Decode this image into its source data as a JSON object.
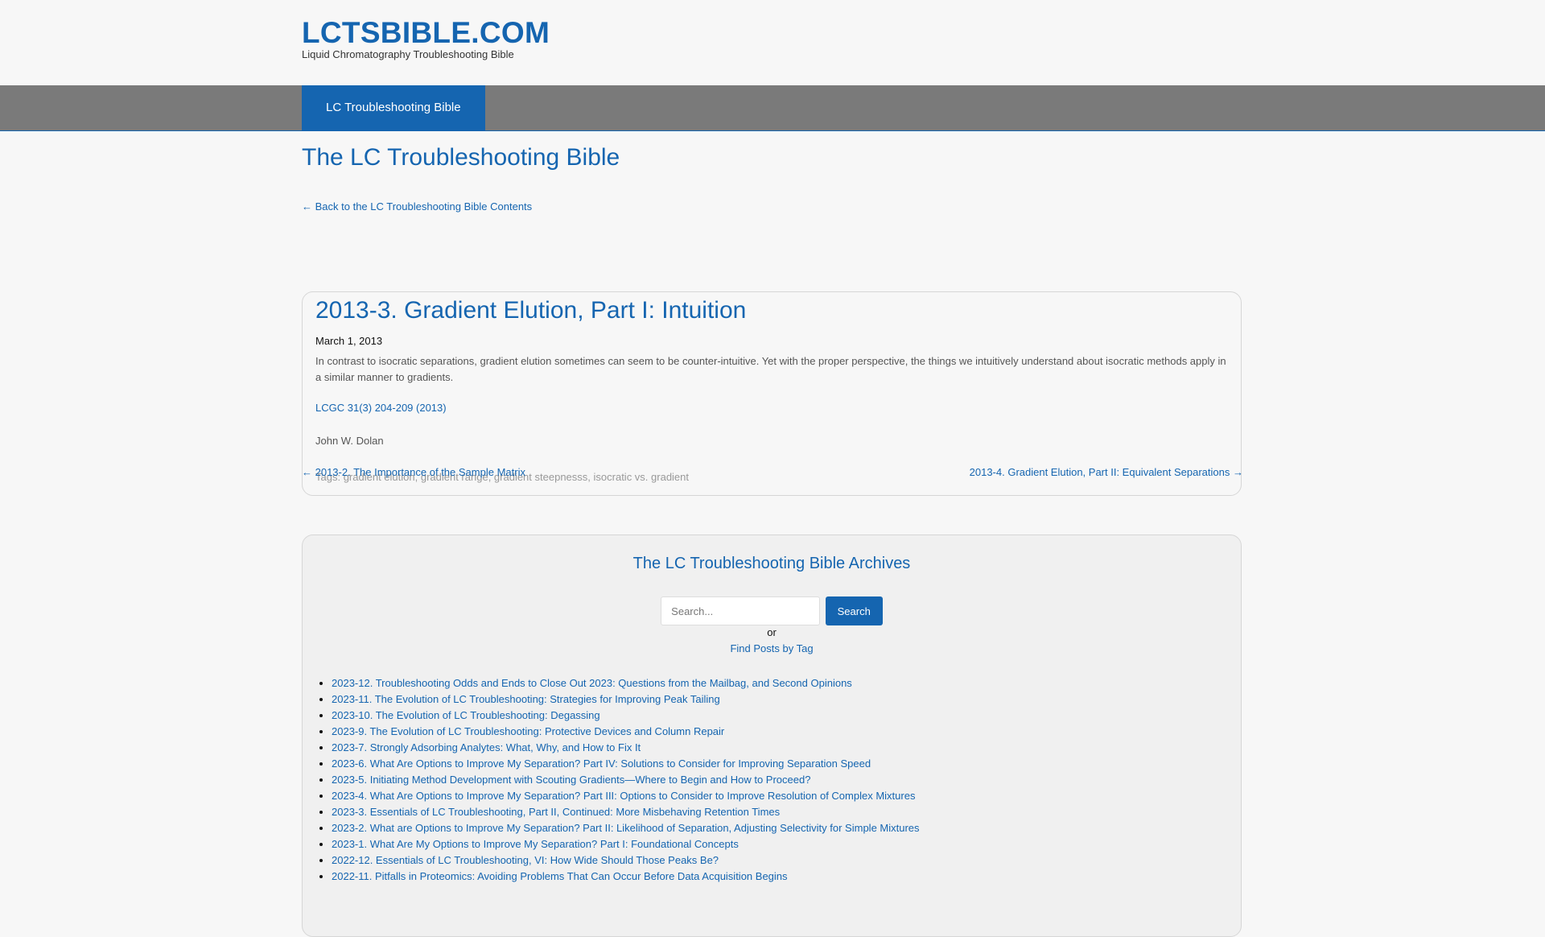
{
  "site": {
    "title": "LCTSBIBLE.COM",
    "description": "Liquid Chromatography Troubleshooting Bible"
  },
  "nav": {
    "items": [
      {
        "label": "LC Troubleshooting Bible"
      }
    ]
  },
  "page": {
    "title": "The LC Troubleshooting Bible",
    "back_link": "← Back to the LC Troubleshooting Bible Contents"
  },
  "post": {
    "title": "2013-3. Gradient Elution, Part I: Intuition",
    "date": "March 1, 2013",
    "body": "In contrast to isocratic separations, gradient elution sometimes can seem to be counter-intuitive. Yet with the proper perspective, the things we intuitively understand about isocratic methods apply in a similar manner to gradients.",
    "citation": "LCGC 31(3) 204-209 (2013)",
    "author": "John W. Dolan",
    "tags_label": "Tags:",
    "tags": [
      "gradient elution",
      "gradient range",
      "gradient steepnesss",
      "isocratic vs. gradient"
    ]
  },
  "post_nav": {
    "prev": "← 2013-2. The Importance of the Sample Matrix",
    "next": "2013-4. Gradient Elution, Part II: Equivalent Separations →"
  },
  "archives": {
    "title": "The LC Troubleshooting Bible Archives",
    "search_placeholder": "Search...",
    "search_button": "Search",
    "or_text": "or",
    "tag_link": "Find Posts by Tag",
    "items": [
      "2023-12. Troubleshooting Odds and Ends to Close Out 2023: Questions from the Mailbag, and Second Opinions",
      "2023-11. The Evolution of LC Troubleshooting: Strategies for Improving Peak Tailing",
      "2023-10. The Evolution of LC Troubleshooting: Degassing",
      "2023-9. The Evolution of LC Troubleshooting: Protective Devices and Column Repair",
      "2023-7. Strongly Adsorbing Analytes: What, Why, and How to Fix It",
      "2023-6. What Are Options to Improve My Separation? Part IV: Solutions to Consider for Improving Separation Speed",
      "2023-5. Initiating Method Development with Scouting Gradients—Where to Begin and How to Proceed?",
      "2023-4. What Are Options to Improve My Separation? Part III: Options to Consider to Improve Resolution of Complex Mixtures",
      "2023-3. Essentials of LC Troubleshooting, Part II, Continued: More Misbehaving Retention Times",
      "2023-2. What are Options to Improve My Separation? Part II: Likelihood of Separation, Adjusting Selectivity for Simple Mixtures",
      "2023-1. What Are My Options to Improve My Separation? Part I: Foundational Concepts",
      "2022-12. Essentials of LC Troubleshooting, VI: How Wide Should Those Peaks Be?",
      "2022-11. Pitfalls in Proteomics: Avoiding Problems That Can Occur Before Data Acquisition Begins"
    ]
  }
}
